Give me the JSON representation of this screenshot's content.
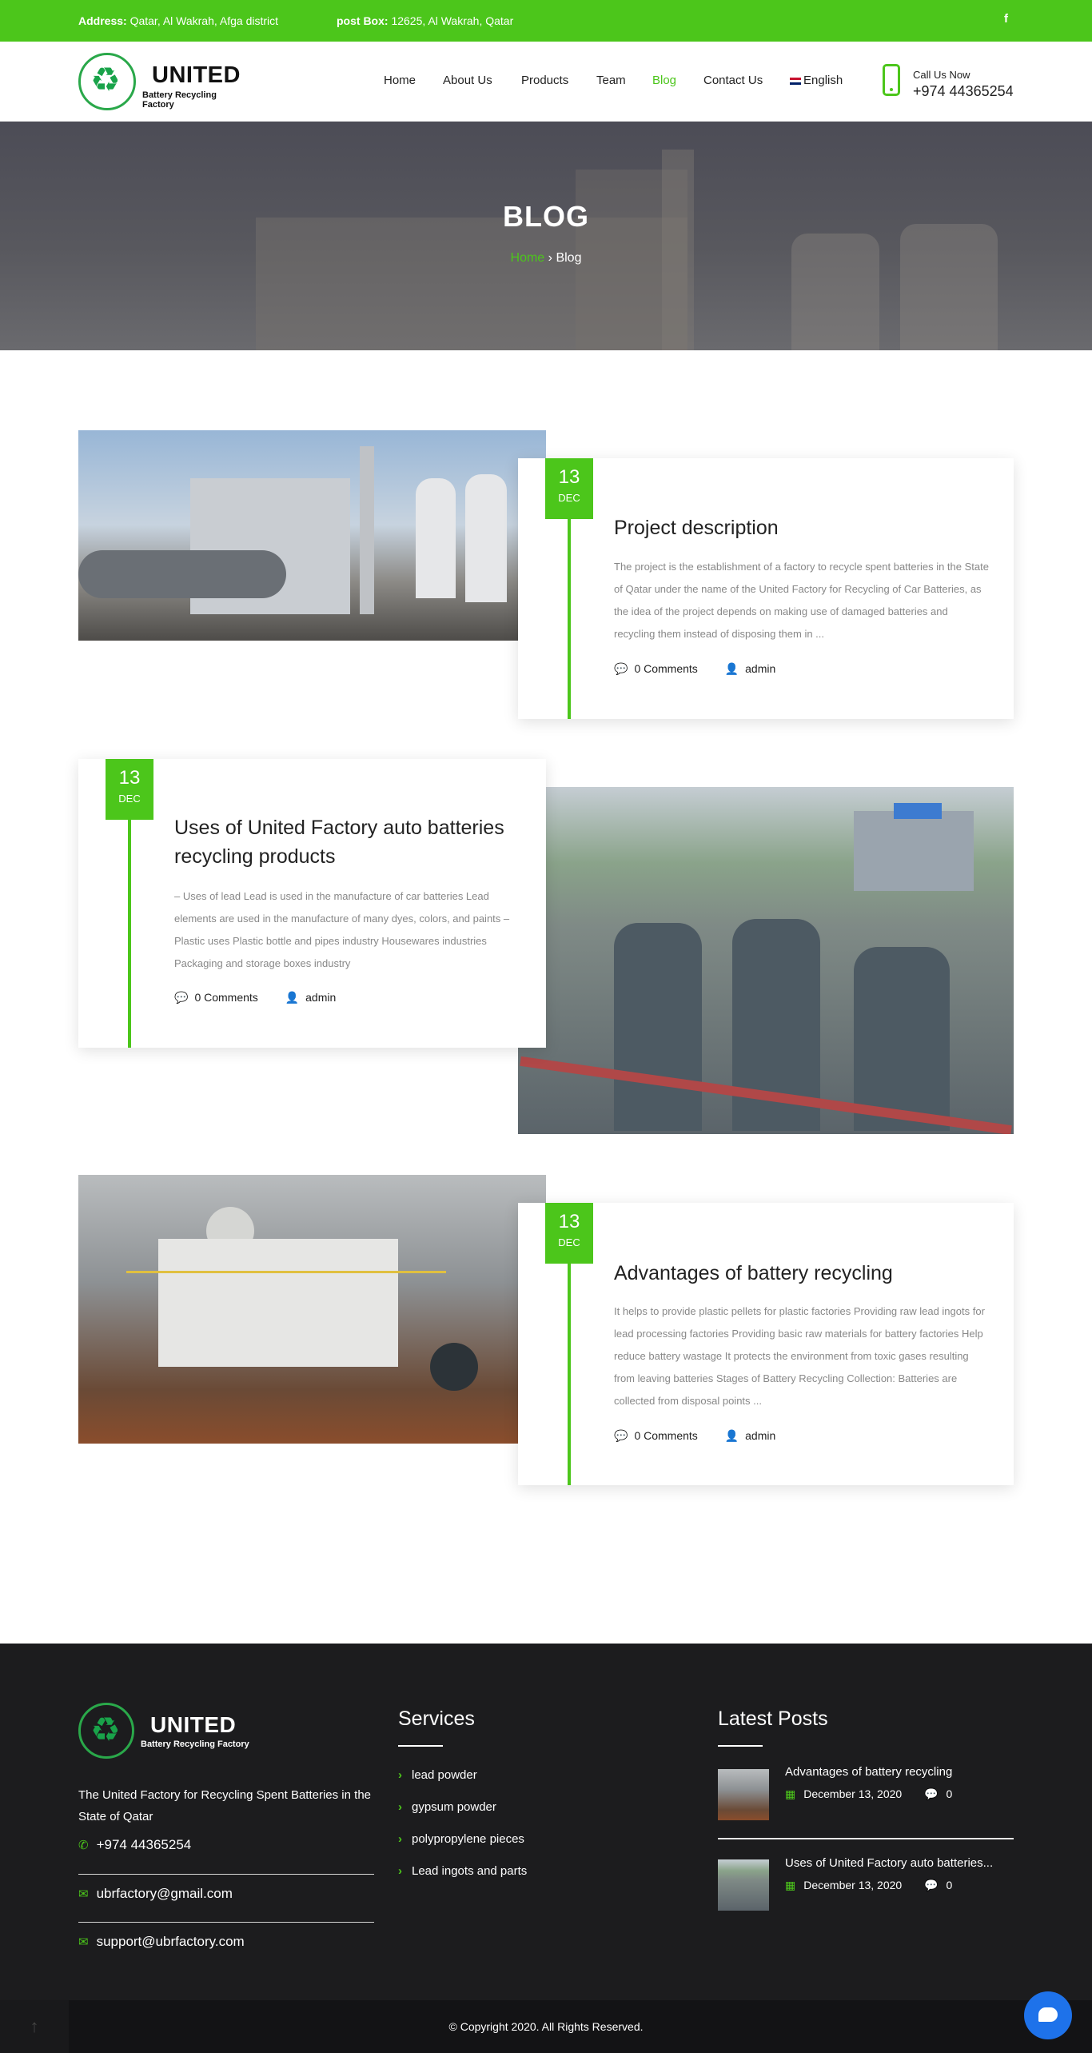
{
  "topbar": {
    "address_label": "Address:",
    "address_value": "Qatar, Al Wakrah, Afga district",
    "postbox_label": "post Box:",
    "postbox_value": "12625, Al Wakrah, Qatar",
    "facebook_glyph": "f"
  },
  "brand": {
    "name": "UNITED",
    "tagline": "Battery Recycling Factory",
    "logo_icon": "recycle-icon"
  },
  "nav": {
    "items": [
      {
        "label": "Home"
      },
      {
        "label": "About Us"
      },
      {
        "label": "Products"
      },
      {
        "label": "Team"
      },
      {
        "label": "Blog",
        "active": true
      },
      {
        "label": "Contact Us"
      }
    ],
    "language": "English"
  },
  "call": {
    "label": "Call Us Now",
    "number": "+974 44365254"
  },
  "hero": {
    "title": "BLOG",
    "breadcrumb_home": "Home",
    "breadcrumb_sep": "›",
    "breadcrumb_current": "Blog"
  },
  "posts": [
    {
      "day": "13",
      "month": "DEC",
      "title": "Project description",
      "excerpt": "The project is the establishment of a factory to recycle spent batteries in the State of Qatar under the name of the United Factory for Recycling of Car Batteries, as the idea of the project depends on making use of damaged batteries and recycling them instead of disposing them in ...",
      "comments": "0 Comments",
      "author": "admin"
    },
    {
      "day": "13",
      "month": "DEC",
      "title": "Uses of United Factory auto batteries recycling products",
      "excerpt": "– Uses of lead Lead is used in the manufacture of car batteries Lead elements are used in the manufacture of many dyes, colors, and paints –  Plastic uses Plastic bottle and pipes industry Housewares industries Packaging and storage boxes industry",
      "comments": "0 Comments",
      "author": "admin"
    },
    {
      "day": "13",
      "month": "DEC",
      "title": "Advantages of battery recycling",
      "excerpt": " It helps to provide plastic pellets for plastic factories Providing raw lead ingots for lead processing factories Providing basic raw materials for battery factories Help reduce battery wastage It protects the environment from toxic gases resulting from leaving batteries Stages of Battery Recycling Collection: Batteries are collected from disposal points ...",
      "comments": "0 Comments",
      "author": "admin"
    }
  ],
  "footer": {
    "about": "The United Factory for Recycling Spent Batteries in the State of Qatar",
    "phone": "+974 44365254",
    "email1": "ubrfactory@gmail.com",
    "email2": "support@ubrfactory.com",
    "services_title": "Services",
    "services": [
      "lead powder",
      "gypsum powder",
      "polypropylene pieces",
      "Lead ingots and parts"
    ],
    "latest_title": "Latest Posts",
    "latest": [
      {
        "title": "Advantages of battery recycling",
        "date": "December 13, 2020",
        "comments": "0"
      },
      {
        "title": "Uses of United Factory auto batteries...",
        "date": "December 13, 2020",
        "comments": "0"
      }
    ],
    "copyright": "© Copyright 2020. All Rights Reserved."
  },
  "colors": {
    "accent": "#4cc61b",
    "footer_bg": "#1c1c1e",
    "chat": "#1e72ea"
  }
}
